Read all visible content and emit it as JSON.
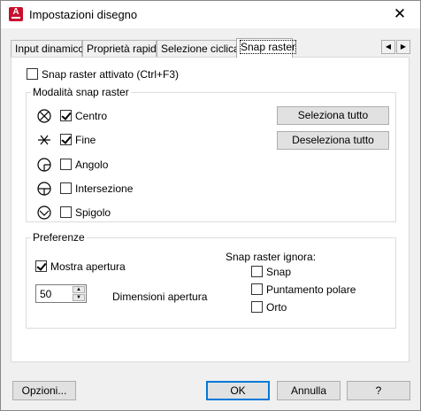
{
  "window": {
    "title": "Impostazioni disegno",
    "close_glyph": "✕"
  },
  "tabs": [
    {
      "label": "Input dinamico",
      "active": false
    },
    {
      "label": "Proprietà rapide",
      "active": false
    },
    {
      "label": "Selezione ciclica",
      "active": false
    },
    {
      "label": "Snap raster",
      "active": true
    }
  ],
  "snap_toggle": {
    "label": "Snap raster attivato (Ctrl+F3)",
    "checked": false
  },
  "modes_group": {
    "title": "Modalità snap raster",
    "items": [
      {
        "label": "Centro",
        "checked": true,
        "icon": "center-icon"
      },
      {
        "label": "Fine",
        "checked": true,
        "icon": "endpoint-icon"
      },
      {
        "label": "Angolo",
        "checked": false,
        "icon": "corner-icon"
      },
      {
        "label": "Intersezione",
        "checked": false,
        "icon": "intersection-icon"
      },
      {
        "label": "Spigolo",
        "checked": false,
        "icon": "edge-icon"
      }
    ],
    "select_all": "Seleziona tutto",
    "deselect_all": "Deseleziona tutto"
  },
  "prefs_group": {
    "title": "Preferenze",
    "show_aperture": {
      "label": "Mostra apertura",
      "checked": true
    },
    "aperture_value": "50",
    "aperture_label": "Dimensioni apertura",
    "ignore_title": "Snap raster ignora:",
    "ignore_items": [
      {
        "label": "Snap",
        "checked": false
      },
      {
        "label": "Puntamento polare",
        "checked": false
      },
      {
        "label": "Orto",
        "checked": false
      }
    ]
  },
  "footer": {
    "options": "Opzioni...",
    "ok": "OK",
    "cancel": "Annulla",
    "help": "?"
  },
  "colors": {
    "accent": "#0078d7",
    "app_icon": "#c8102e"
  }
}
